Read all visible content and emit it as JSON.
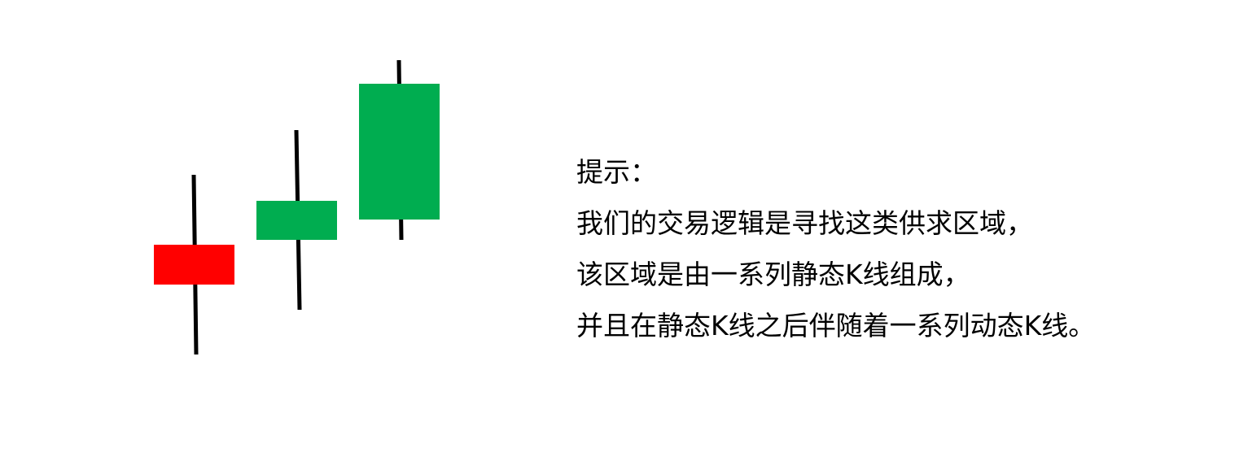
{
  "hint": {
    "title": "提示：",
    "lines": [
      "我们的交易逻辑是寻找这类供求区域，",
      "该区域是由一系列静态K线组成，",
      "并且在静态K线之后伴随着一系列动态K线。"
    ]
  },
  "candles": [
    {
      "color": "#ff0000",
      "type": "bearish"
    },
    {
      "color": "#00ad50",
      "type": "bullish"
    },
    {
      "color": "#00ad50",
      "type": "bullish"
    }
  ]
}
